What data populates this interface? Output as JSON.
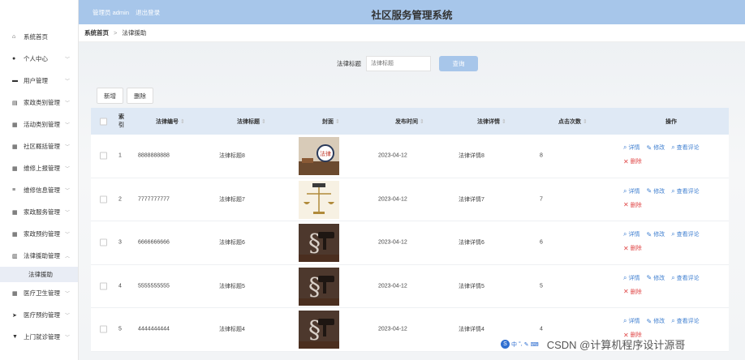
{
  "header": {
    "user_role": "管理员 admin",
    "logout": "退出登录",
    "title": "社区服务管理系统"
  },
  "sidebar": {
    "items": [
      {
        "label": "系统首页",
        "icon": "home-icon",
        "has_chevron": false
      },
      {
        "label": "个人中心",
        "icon": "person-icon",
        "has_chevron": true
      },
      {
        "label": "用户管理",
        "icon": "briefcase-icon",
        "has_chevron": true
      },
      {
        "label": "家政类别管理",
        "icon": "list-icon",
        "has_chevron": true
      },
      {
        "label": "活动类别管理",
        "icon": "grid-icon",
        "has_chevron": true
      },
      {
        "label": "社区概括管理",
        "icon": "grid-icon",
        "has_chevron": true
      },
      {
        "label": "维修上报管理",
        "icon": "table-icon",
        "has_chevron": true
      },
      {
        "label": "维修信息管理",
        "icon": "sliders-icon",
        "has_chevron": true
      },
      {
        "label": "家政服务管理",
        "icon": "grid-icon",
        "has_chevron": true
      },
      {
        "label": "家政预约管理",
        "icon": "grid-icon",
        "has_chevron": true
      },
      {
        "label": "法律援助管理",
        "icon": "chart-icon",
        "has_chevron": true,
        "expanded": true
      },
      {
        "label": "医疗卫生管理",
        "icon": "grid-icon",
        "has_chevron": true
      },
      {
        "label": "医疗预约管理",
        "icon": "send-icon",
        "has_chevron": true
      },
      {
        "label": "上门就诊管理",
        "icon": "funnel-icon",
        "has_chevron": true
      }
    ],
    "sub_item": "法律援助"
  },
  "breadcrumb": {
    "home": "系统首页",
    "separator": ">",
    "current": "法律援助"
  },
  "search": {
    "label": "法律标题",
    "placeholder": "法律标题",
    "button": "查询"
  },
  "toolbar": {
    "add": "新增",
    "delete": "删除"
  },
  "table": {
    "columns": [
      "索引",
      "法律编号",
      "法律标题",
      "封面",
      "发布时间",
      "法律详情",
      "点击次数",
      "操作"
    ],
    "rows": [
      {
        "index": "1",
        "code": "8888888888",
        "title": "法律标题8",
        "date": "2023-04-12",
        "detail": "法律详情8",
        "clicks": "8"
      },
      {
        "index": "2",
        "code": "7777777777",
        "title": "法律标题7",
        "date": "2023-04-12",
        "detail": "法律详情7",
        "clicks": "7"
      },
      {
        "index": "3",
        "code": "6666666666",
        "title": "法律标题6",
        "date": "2023-04-12",
        "detail": "法律详情6",
        "clicks": "6"
      },
      {
        "index": "4",
        "code": "5555555555",
        "title": "法律标题5",
        "date": "2023-04-12",
        "detail": "法律详情5",
        "clicks": "5"
      },
      {
        "index": "5",
        "code": "4444444444",
        "title": "法律标题4",
        "date": "2023-04-12",
        "detail": "法律详情4",
        "clicks": "4"
      }
    ],
    "ops": {
      "detail": "详情",
      "edit": "修改",
      "comment": "查看评论",
      "delete": "删除"
    }
  },
  "cover_label": "法律",
  "watermark": "CSDN @计算机程序设计源哥",
  "colors": {
    "header": "#a7c6ea",
    "table_head": "#dfe9f5",
    "link": "#3f7fd0",
    "danger": "#e04848"
  }
}
